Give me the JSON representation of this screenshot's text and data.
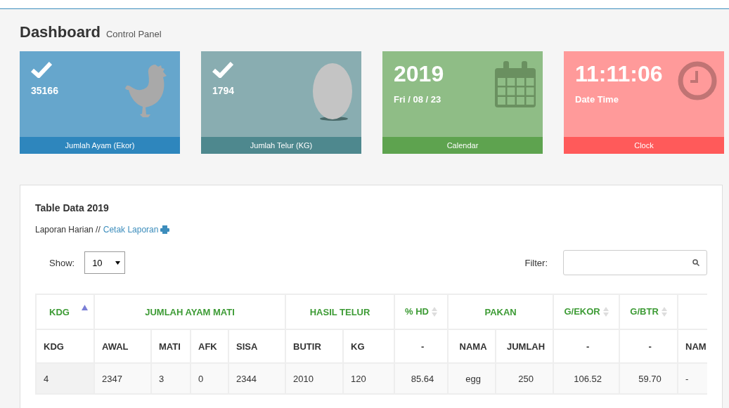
{
  "header": {
    "title": "Dashboard",
    "subtitle": "Control Panel"
  },
  "cards": [
    {
      "kind": "check",
      "value": "35166",
      "footer": "Jumlah Ayam (Ekor)",
      "color": "#66a6cc"
    },
    {
      "kind": "check",
      "value": "1794",
      "footer": "Jumlah Telur (KG)",
      "color": "#89adb1"
    },
    {
      "kind": "big",
      "value": "2019",
      "caption": "Fri / 08 / 23",
      "footer": "Calendar",
      "color": "#8fbd86"
    },
    {
      "kind": "big",
      "value": "11:11:06",
      "caption": "Date Time",
      "footer": "Clock",
      "color": "#ff9a9a"
    }
  ],
  "panel": {
    "title": "Table Data 2019",
    "breadcrumb": "Laporan Harian //",
    "link": "Cetak Laporan",
    "show_label": "Show:",
    "page_size": "10",
    "filter_label": "Filter:",
    "table": {
      "groups": [
        {
          "label": "KDG"
        },
        {
          "label": "JUMLAH AYAM MATI"
        },
        {
          "label": "HASIL TELUR"
        },
        {
          "label": "% HD"
        },
        {
          "label": "PAKAN"
        },
        {
          "label": "G/EKOR"
        },
        {
          "label": "G/BTR"
        }
      ],
      "columns": [
        "KDG",
        "AWAL",
        "MATI",
        "AFK",
        "SISA",
        "BUTIR",
        "KG",
        "-",
        "NAMA",
        "JUMLAH",
        "-",
        "-",
        "NAM"
      ],
      "rows": [
        [
          "4",
          "2347",
          "3",
          "0",
          "2344",
          "2010",
          "120",
          "85.64",
          "egg",
          "250",
          "106.52",
          "59.70",
          "-"
        ]
      ]
    }
  }
}
